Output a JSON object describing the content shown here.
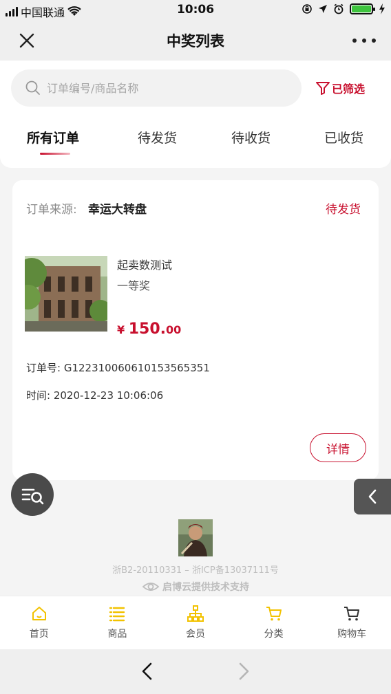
{
  "status_bar": {
    "carrier": "中国联通",
    "time": "10:06",
    "battery_level": 1.0,
    "icons": [
      "signal-icon",
      "wifi-icon",
      "lock-rotation-icon",
      "location-icon",
      "alarm-icon",
      "battery-icon",
      "charging-icon"
    ]
  },
  "nav": {
    "title": "中奖列表",
    "close_icon": "close-icon",
    "more_icon": "more-icon"
  },
  "search": {
    "placeholder": "订单编号/商品名称",
    "filter_label": "已筛选"
  },
  "tabs": [
    {
      "label": "所有订单",
      "active": true
    },
    {
      "label": "待发货",
      "active": false
    },
    {
      "label": "待收货",
      "active": false
    },
    {
      "label": "已收货",
      "active": false
    }
  ],
  "order": {
    "source_label": "订单来源:",
    "source_value": "幸运大转盘",
    "status": "待发货",
    "product_name": "起卖数测试",
    "prize_level": "一等奖",
    "price_currency": "¥",
    "price_int": "150.",
    "price_dec": "00",
    "order_no": "订单号:  G1223100606101535653​51",
    "time": "时间:  2020-12-23 10:06:06",
    "detail_button": "详情"
  },
  "footer": {
    "icp": "浙B2-20110331 – 浙ICP备13037111号",
    "tech": "启博云提供技术支持"
  },
  "tabbar": [
    {
      "label": "首页",
      "icon": "home-icon"
    },
    {
      "label": "商品",
      "icon": "list-icon"
    },
    {
      "label": "会员",
      "icon": "member-icon"
    },
    {
      "label": "分类",
      "icon": "cart-icon"
    },
    {
      "label": "购物车",
      "icon": "cart-icon"
    }
  ],
  "colors": {
    "accent": "#c8102e",
    "tab_icon": "#f2c200"
  }
}
